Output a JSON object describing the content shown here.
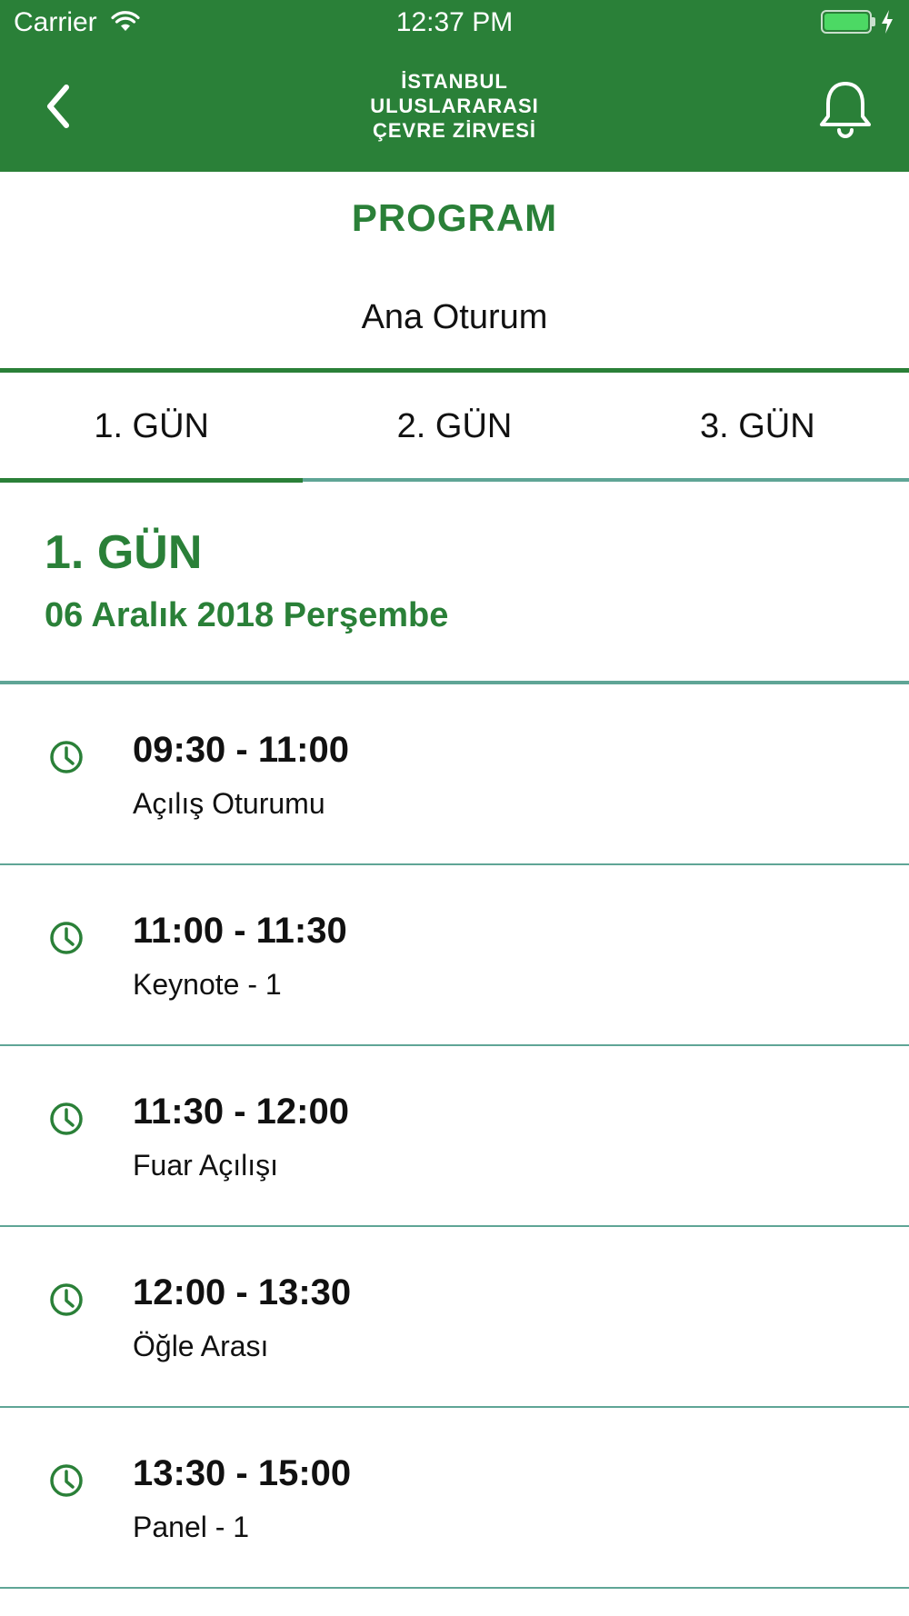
{
  "status_bar": {
    "carrier": "Carrier",
    "time": "12:37 PM"
  },
  "header": {
    "logo_lines": [
      "İSTANBUL",
      "ULUSLARARASI",
      "ÇEVRE ZİRVESİ"
    ],
    "back_icon": "chevron-left-icon",
    "bell_icon": "bell-icon"
  },
  "page": {
    "title": "PROGRAM",
    "session": "Ana Oturum"
  },
  "tabs": [
    {
      "label": "1. GÜN",
      "selected": true
    },
    {
      "label": "2. GÜN",
      "selected": false
    },
    {
      "label": "3. GÜN",
      "selected": false
    }
  ],
  "day": {
    "title": "1. GÜN",
    "date": "06 Aralık 2018 Perşembe"
  },
  "schedule": [
    {
      "time": "09:30 - 11:00",
      "title": "Açılış Oturumu"
    },
    {
      "time": "11:00 - 11:30",
      "title": "Keynote - 1"
    },
    {
      "time": "11:30 - 12:00",
      "title": "Fuar Açılışı"
    },
    {
      "time": "12:00 - 13:30",
      "title": "Öğle Arası"
    },
    {
      "time": "13:30 - 15:00",
      "title": "Panel - 1"
    }
  ],
  "colors": {
    "brand_green": "#2a8038",
    "divider_teal": "#5fa596",
    "battery_green": "#4cd964"
  }
}
